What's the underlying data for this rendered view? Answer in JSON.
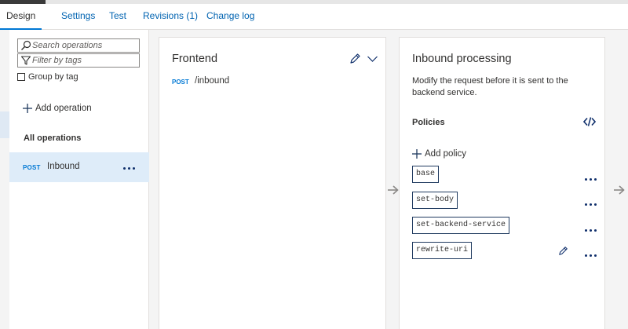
{
  "tabs": [
    {
      "label": "Design",
      "active": true
    },
    {
      "label": "Settings"
    },
    {
      "label": "Test"
    },
    {
      "label": "Revisions (1)"
    },
    {
      "label": "Change log"
    }
  ],
  "operations": {
    "search_placeholder": "Search operations",
    "filter_placeholder": "Filter by tags",
    "group_by_tag_label": "Group by tag",
    "group_by_tag_checked": false,
    "add_operation_label": "Add operation",
    "all_operations_label": "All operations",
    "items": [
      {
        "method": "POST",
        "name": "Inbound",
        "selected": true
      }
    ]
  },
  "frontend": {
    "title": "Frontend",
    "method": "POST",
    "path": "/inbound"
  },
  "inbound": {
    "title": "Inbound processing",
    "description": "Modify the request before it is sent to the backend service.",
    "policies_label": "Policies",
    "add_policy_label": "Add policy",
    "policies": [
      "base",
      "set-body",
      "set-backend-service",
      "rewrite-uri"
    ]
  },
  "icons": {
    "search": "search-icon",
    "filter": "filter-icon",
    "add": "plus-icon",
    "more": "more-icon",
    "edit": "pencil-icon",
    "expand": "chevron-down-icon",
    "code": "code-icon",
    "arrow": "arrow-right-icon"
  },
  "colors": {
    "accent": "#0078d4",
    "link": "#0063b1",
    "selected_bg": "#deecf9",
    "method_text": "#0078d4"
  }
}
